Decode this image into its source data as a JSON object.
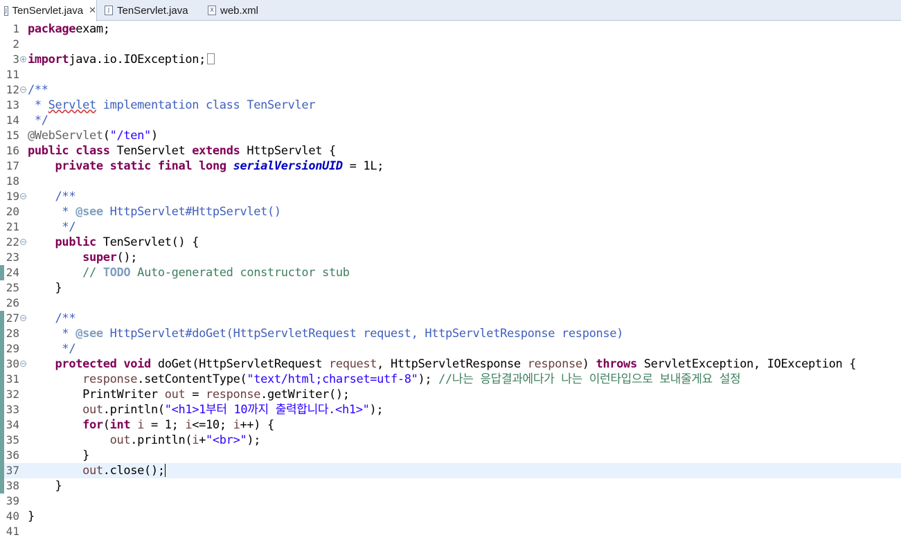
{
  "tabs": [
    {
      "label": "TenServlet.java",
      "icon": "java-file-icon",
      "active": true,
      "close": "✕"
    },
    {
      "label": "TenServlet.java",
      "icon": "java-file-icon",
      "active": false
    },
    {
      "label": "web.xml",
      "icon": "xml-file-icon",
      "active": false
    }
  ],
  "colors": {
    "keyword": "#7f0055",
    "string": "#2a00ff",
    "comment": "#3f7f5f",
    "javadoc": "#3f5fbf",
    "annotation": "#646464",
    "field": "#0000c0",
    "current_line": "#e8f2fe"
  },
  "lines": [
    {
      "num": "1",
      "segments": [
        [
          "kw",
          "package"
        ],
        [
          "",
          "exam;"
        ]
      ]
    },
    {
      "num": "2",
      "segments": []
    },
    {
      "num": "3",
      "fold": "expand",
      "segments": [
        [
          "kw",
          "import"
        ],
        [
          "",
          "java.io.IOException;"
        ]
      ],
      "folded_box": true
    },
    {
      "num": "11",
      "segments": []
    },
    {
      "num": "12",
      "fold": "collapse",
      "segments": [
        [
          "jdoc",
          "/**"
        ]
      ]
    },
    {
      "num": "13",
      "segments": [
        [
          "jdoc",
          " * "
        ],
        [
          "jdoc-squig",
          "Servlet"
        ],
        [
          "jdoc",
          " implementation class TenServler"
        ]
      ]
    },
    {
      "num": "14",
      "segments": [
        [
          "jdoc",
          " */"
        ]
      ]
    },
    {
      "num": "15",
      "segments": [
        [
          "ann",
          "@WebServlet"
        ],
        [
          "",
          "("
        ],
        [
          "str",
          "\"/ten\""
        ],
        [
          "",
          ")"
        ]
      ]
    },
    {
      "num": "16",
      "segments": [
        [
          "kw",
          "public"
        ],
        [
          "",
          " "
        ],
        [
          "kw",
          "class"
        ],
        [
          "",
          " TenServlet "
        ],
        [
          "kw",
          "extends"
        ],
        [
          "",
          " HttpServlet {"
        ]
      ]
    },
    {
      "num": "17",
      "segments": [
        [
          "",
          "    "
        ],
        [
          "kw",
          "private"
        ],
        [
          "",
          " "
        ],
        [
          "kw",
          "static"
        ],
        [
          "",
          " "
        ],
        [
          "kw",
          "final"
        ],
        [
          "",
          " "
        ],
        [
          "kw",
          "long"
        ],
        [
          "",
          " "
        ],
        [
          "fld",
          "serialVersionUID"
        ],
        [
          "",
          " = 1L;"
        ]
      ]
    },
    {
      "num": "18",
      "segments": []
    },
    {
      "num": "19",
      "fold": "collapse",
      "segments": [
        [
          "",
          "    "
        ],
        [
          "jdoc",
          "/**"
        ]
      ]
    },
    {
      "num": "20",
      "segments": [
        [
          "",
          "    "
        ],
        [
          "jdoc",
          " * "
        ],
        [
          "jtag",
          "@see"
        ],
        [
          "jdoc",
          " HttpServlet#HttpServlet()"
        ]
      ]
    },
    {
      "num": "21",
      "segments": [
        [
          "",
          "    "
        ],
        [
          "jdoc",
          " */"
        ]
      ]
    },
    {
      "num": "22",
      "fold": "collapse",
      "segments": [
        [
          "",
          "    "
        ],
        [
          "kw",
          "public"
        ],
        [
          "",
          " TenServlet() {"
        ]
      ]
    },
    {
      "num": "23",
      "segments": [
        [
          "",
          "        "
        ],
        [
          "kw",
          "super"
        ],
        [
          "",
          "();"
        ]
      ]
    },
    {
      "num": "24",
      "marker": true,
      "segments": [
        [
          "",
          "        "
        ],
        [
          "cmt",
          "// "
        ],
        [
          "todo",
          "TODO"
        ],
        [
          "cmt",
          " Auto-generated constructor stub"
        ]
      ]
    },
    {
      "num": "25",
      "segments": [
        [
          "",
          "    }"
        ]
      ]
    },
    {
      "num": "26",
      "segments": []
    },
    {
      "num": "27",
      "fold": "collapse",
      "marker": true,
      "segments": [
        [
          "",
          "    "
        ],
        [
          "jdoc",
          "/**"
        ]
      ]
    },
    {
      "num": "28",
      "marker": true,
      "segments": [
        [
          "",
          "    "
        ],
        [
          "jdoc",
          " * "
        ],
        [
          "jtag",
          "@see"
        ],
        [
          "jdoc",
          " HttpServlet#doGet(HttpServletRequest request, HttpServletResponse response)"
        ]
      ]
    },
    {
      "num": "29",
      "marker": true,
      "segments": [
        [
          "",
          "    "
        ],
        [
          "jdoc",
          " */"
        ]
      ]
    },
    {
      "num": "30",
      "fold": "collapse",
      "marker": true,
      "segments": [
        [
          "",
          "    "
        ],
        [
          "kw",
          "protected"
        ],
        [
          "",
          " "
        ],
        [
          "kw",
          "void"
        ],
        [
          "",
          " doGet(HttpServletRequest "
        ],
        [
          "var",
          "request"
        ],
        [
          "",
          ", HttpServletResponse "
        ],
        [
          "var",
          "response"
        ],
        [
          "",
          ") "
        ],
        [
          "kw",
          "throws"
        ],
        [
          "",
          " ServletException, IOException {"
        ]
      ]
    },
    {
      "num": "31",
      "marker": true,
      "segments": [
        [
          "",
          "        "
        ],
        [
          "var",
          "response"
        ],
        [
          "",
          ".setContentType("
        ],
        [
          "str",
          "\"text/html;charset=utf-8\""
        ],
        [
          "",
          "); "
        ],
        [
          "cmt",
          "//나는 응답결과에다가 나는 이런타입으로 보내줄게요 설정"
        ]
      ]
    },
    {
      "num": "32",
      "marker": true,
      "segments": [
        [
          "",
          "        PrintWriter "
        ],
        [
          "var",
          "out"
        ],
        [
          "",
          " = "
        ],
        [
          "var",
          "response"
        ],
        [
          "",
          ".getWriter();"
        ]
      ]
    },
    {
      "num": "33",
      "marker": true,
      "segments": [
        [
          "",
          "        "
        ],
        [
          "var",
          "out"
        ],
        [
          "",
          ".println("
        ],
        [
          "str",
          "\"<h1>1부터 10까지 출력합니다.<h1>\""
        ],
        [
          "",
          ");"
        ]
      ]
    },
    {
      "num": "34",
      "marker": true,
      "segments": [
        [
          "",
          "        "
        ],
        [
          "kw",
          "for"
        ],
        [
          "",
          "("
        ],
        [
          "kw",
          "int"
        ],
        [
          "",
          " "
        ],
        [
          "var",
          "i"
        ],
        [
          "",
          " = 1; "
        ],
        [
          "var",
          "i"
        ],
        [
          "",
          "<=10; "
        ],
        [
          "var",
          "i"
        ],
        [
          "",
          "++) {"
        ]
      ]
    },
    {
      "num": "35",
      "marker": true,
      "segments": [
        [
          "",
          "            "
        ],
        [
          "var",
          "out"
        ],
        [
          "",
          ".println("
        ],
        [
          "var",
          "i"
        ],
        [
          "",
          "+"
        ],
        [
          "str",
          "\"<br>\""
        ],
        [
          "",
          ");"
        ]
      ]
    },
    {
      "num": "36",
      "marker": true,
      "segments": [
        [
          "",
          "        }"
        ]
      ]
    },
    {
      "num": "37",
      "marker": true,
      "current": true,
      "segments": [
        [
          "",
          "        "
        ],
        [
          "var",
          "out"
        ],
        [
          "",
          ".close();"
        ]
      ],
      "caret": true
    },
    {
      "num": "38",
      "marker": true,
      "segments": [
        [
          "",
          "    }"
        ]
      ]
    },
    {
      "num": "39",
      "segments": []
    },
    {
      "num": "40",
      "segments": [
        [
          "",
          "}"
        ]
      ]
    },
    {
      "num": "41",
      "segments": []
    }
  ]
}
